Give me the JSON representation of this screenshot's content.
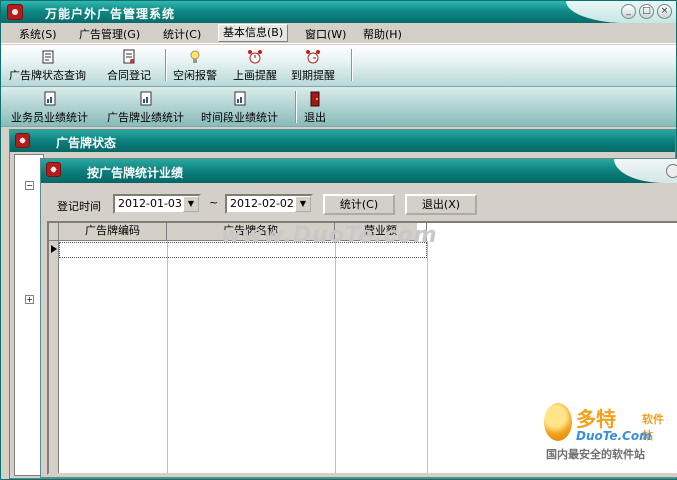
{
  "app": {
    "title": "万能户外广告管理系统",
    "window_buttons": [
      "minimize",
      "restore",
      "close"
    ]
  },
  "menu": [
    {
      "label": "系统(S)"
    },
    {
      "label": "广告管理(G)"
    },
    {
      "label": "统计(C)"
    },
    {
      "label": "基本信息(B)"
    },
    {
      "label": "窗口(W)"
    },
    {
      "label": "帮助(H)"
    }
  ],
  "toolbar1": [
    {
      "label": "广告牌状态查询",
      "icon": "query-icon"
    },
    {
      "label": "合同登记",
      "icon": "contract-icon"
    },
    {
      "label": "空闲报警",
      "icon": "lightbulb-icon"
    },
    {
      "label": "上画提醒",
      "icon": "alarm-clock-icon"
    },
    {
      "label": "到期提醒",
      "icon": "alarm-clock-icon"
    }
  ],
  "toolbar2": [
    {
      "label": "业务员业绩统计",
      "icon": "report-icon"
    },
    {
      "label": "广告牌业绩统计",
      "icon": "report-icon"
    },
    {
      "label": "时间段业绩统计",
      "icon": "report-icon"
    },
    {
      "label": "退出",
      "icon": "exit-door-icon"
    }
  ],
  "child_window_1": {
    "title": "广告牌状态"
  },
  "child_window_2": {
    "title": "按广告牌统计业绩",
    "filter": {
      "label": "登记时间",
      "date_from": "2012-01-03",
      "separator": "~",
      "date_to": "2012-02-02",
      "stat_button": "统计(C)",
      "exit_button": "退出(X)"
    },
    "grid": {
      "columns": [
        "广告牌编码",
        "广告牌名称",
        "营业额"
      ]
    }
  },
  "watermark": "www.DuoTe.com",
  "brand": {
    "main": "多特",
    "sub": "软件站",
    "url": "DuoTe.Com",
    "tagline": "国内最安全的软件站"
  },
  "colors": {
    "titlebar": "#0e8a87",
    "face": "#d4d0c8",
    "logo_orange": "#f4a01c",
    "logo_blue": "#3a8edb"
  }
}
